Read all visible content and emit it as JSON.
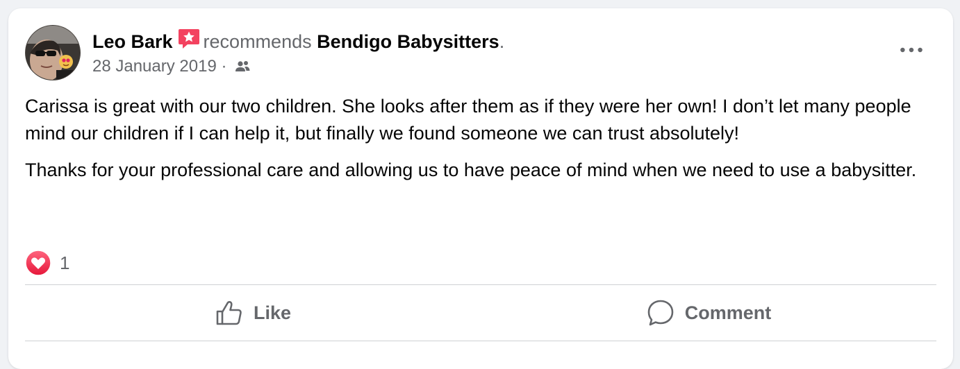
{
  "post": {
    "author": "Leo Bark",
    "verb": "recommends",
    "page": "Bendigo Babysitters",
    "period": ".",
    "date": "28 January 2019",
    "separator": "·",
    "body": [
      "Carissa is great with our two children. She looks after them as if they were her own! I don’t let many people mind our children if I can help it, but finally we found someone we can trust absolutely!",
      "Thanks for your professional care and allowing us to have peace of mind when we need to use a babysitter."
    ],
    "reaction_count": "1"
  },
  "actions": {
    "like_label": "Like",
    "comment_label": "Comment"
  },
  "icons": {
    "recommend": "recommend-star-icon",
    "audience": "friends-icon",
    "more": "more-options-icon",
    "reaction": "love-reaction-icon",
    "like": "thumbs-up-icon",
    "comment": "comment-bubble-icon"
  },
  "colors": {
    "text_primary": "#050505",
    "text_secondary": "#65676b",
    "recommend_accent": "#f3425f",
    "love_red": "#f33e58",
    "divider": "#ced0d4"
  }
}
